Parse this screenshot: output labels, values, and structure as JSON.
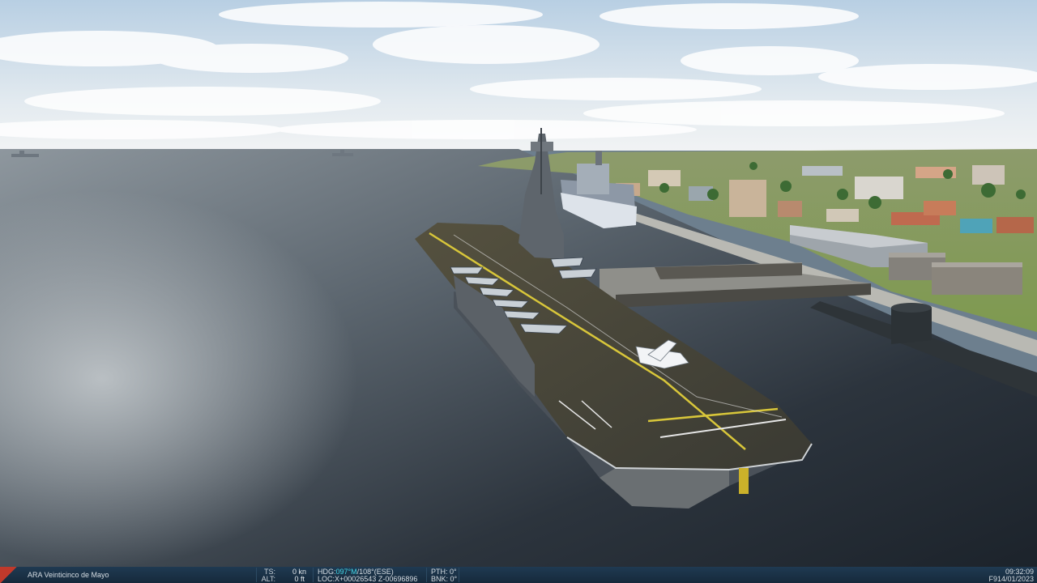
{
  "scene": {
    "description_tags": [
      "aircraft-carrier",
      "harbor",
      "city",
      "submarine",
      "support-ship"
    ],
    "colors": {
      "sky_top": "#bcd3e6",
      "sky_horizon": "#eef2f4",
      "sea_dark": "#222a33",
      "sea_light": "#9aa3aa",
      "deck": "#3e3b34",
      "hull": "#4a5159",
      "grass": "#8aa25a",
      "stripe_yellow": "#d8c63a"
    }
  },
  "status_bar": {
    "unit_name": "ARA Veinticinco de Mayo",
    "ts_label": "TS:",
    "ts_value": "0 kn",
    "alt_label": "ALT:",
    "alt_value": "0 ft",
    "hdg_label": "HDG:",
    "hdg_value": "097°M",
    "hdg_true": "/108°(ESE)",
    "loc_label": "LOC:",
    "loc_value": "X+00026543 Z-00696896",
    "pth_label": "PTH:",
    "pth_value": "0°",
    "bnk_label": "BNK:",
    "bnk_value": "0°",
    "time": "09:32:09",
    "date": "F914/01/2023"
  }
}
